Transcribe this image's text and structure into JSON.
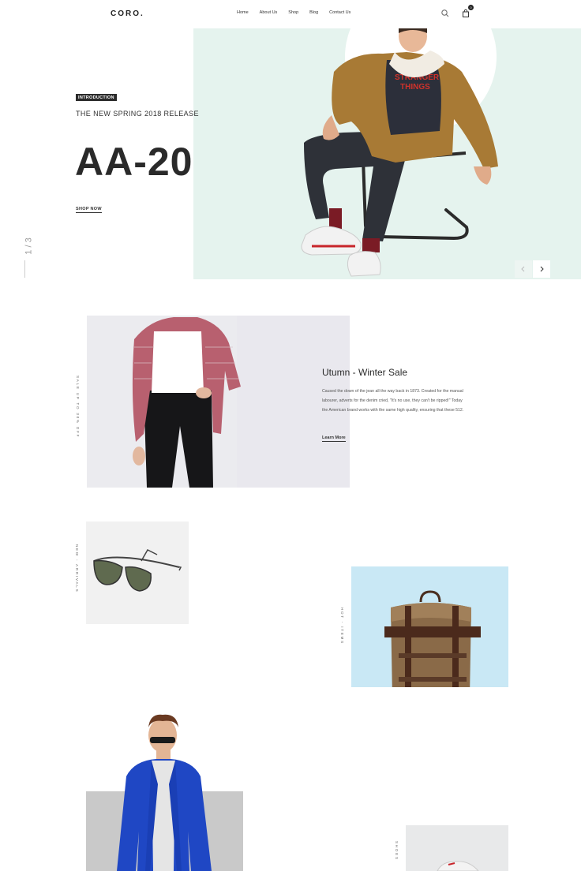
{
  "header": {
    "logo": "CORO",
    "logo_dot": ".",
    "nav": [
      "Home",
      "About Us",
      "Shop",
      "Blog",
      "Contact Us"
    ],
    "cart_count": "0"
  },
  "hero": {
    "tag": "INTRODUCTION",
    "subtitle": "THE NEW SPRING 2018 RELEASE",
    "title": "AA-20",
    "link": "SHOP NOW",
    "slide_counter": "1 / 3",
    "shirt_text_1": "STRANGER",
    "shirt_text_2": "THINGS"
  },
  "sale": {
    "vertical_label": "SALE UP TO 30% OFF",
    "title": "Utumn - Winter Sale",
    "text": "Caused the down of the jean all the way back in 1873. Created for the manual labourer, adverts for the denim cried, \"It's no use, they can't be ripped!\" Today the American brand works with the same high quality, ensuring that these 512.",
    "link": "Learn More"
  },
  "arrivals": {
    "vertical_label": "NEW - ARRIVALS"
  },
  "hot": {
    "vertical_label": "HOT - ITEMS"
  },
  "shoes": {
    "vertical_label": "SHOES"
  },
  "colors": {
    "hero_bg": "#e5f3ee",
    "sale_bg": "#ebebef",
    "glasses_bg": "#f1f1f1",
    "bag_bg": "#c9e8f5",
    "jacket_bg": "#c9c9c9",
    "shoes_bg": "#e8e9ea",
    "accent": "#2b2b2b"
  }
}
